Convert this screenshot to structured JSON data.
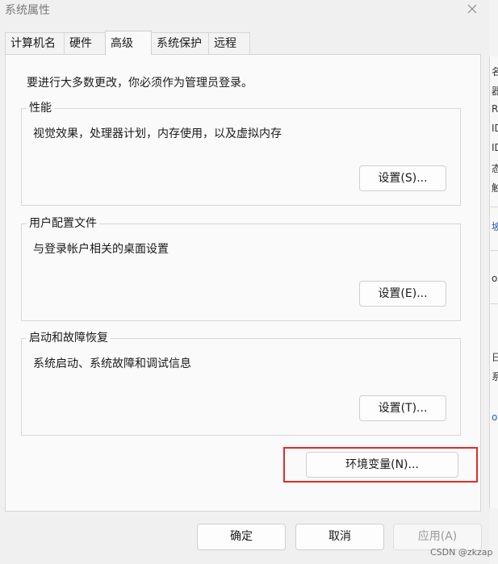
{
  "window": {
    "title": "系统属性",
    "close_icon": "close-icon"
  },
  "tabs": [
    {
      "label": "计算机名",
      "active": false
    },
    {
      "label": "硬件",
      "active": false
    },
    {
      "label": "高级",
      "active": true
    },
    {
      "label": "系统保护",
      "active": false
    },
    {
      "label": "远程",
      "active": false
    }
  ],
  "page": {
    "admin_note": "要进行大多数更改，你必须作为管理员登录。",
    "groups": [
      {
        "title": "性能",
        "description": "视觉效果，处理器计划，内存使用，以及虚拟内存",
        "button": "设置(S)..."
      },
      {
        "title": "用户配置文件",
        "description": "与登录帐户相关的桌面设置",
        "button": "设置(E)..."
      },
      {
        "title": "启动和故障恢复",
        "description": "系统启动、系统故障和调试信息",
        "button": "设置(T)..."
      }
    ],
    "env_button": "环境变量(N)..."
  },
  "footer": {
    "ok": "确定",
    "cancel": "取消",
    "apply": "应用(A)",
    "apply_enabled": false
  },
  "background_window": {
    "glyphs": [
      "名",
      "器",
      "RA",
      "ID",
      "ID",
      "态",
      "触",
      "坡",
      "ov",
      "日",
      "系",
      "os"
    ]
  },
  "watermark": "CSDN @zkzap",
  "colors": {
    "highlight_border": "#e02b2b",
    "dialog_bg": "#f0f0f0",
    "page_bg": "#fafafa",
    "disabled_text": "#9b9b9b"
  }
}
